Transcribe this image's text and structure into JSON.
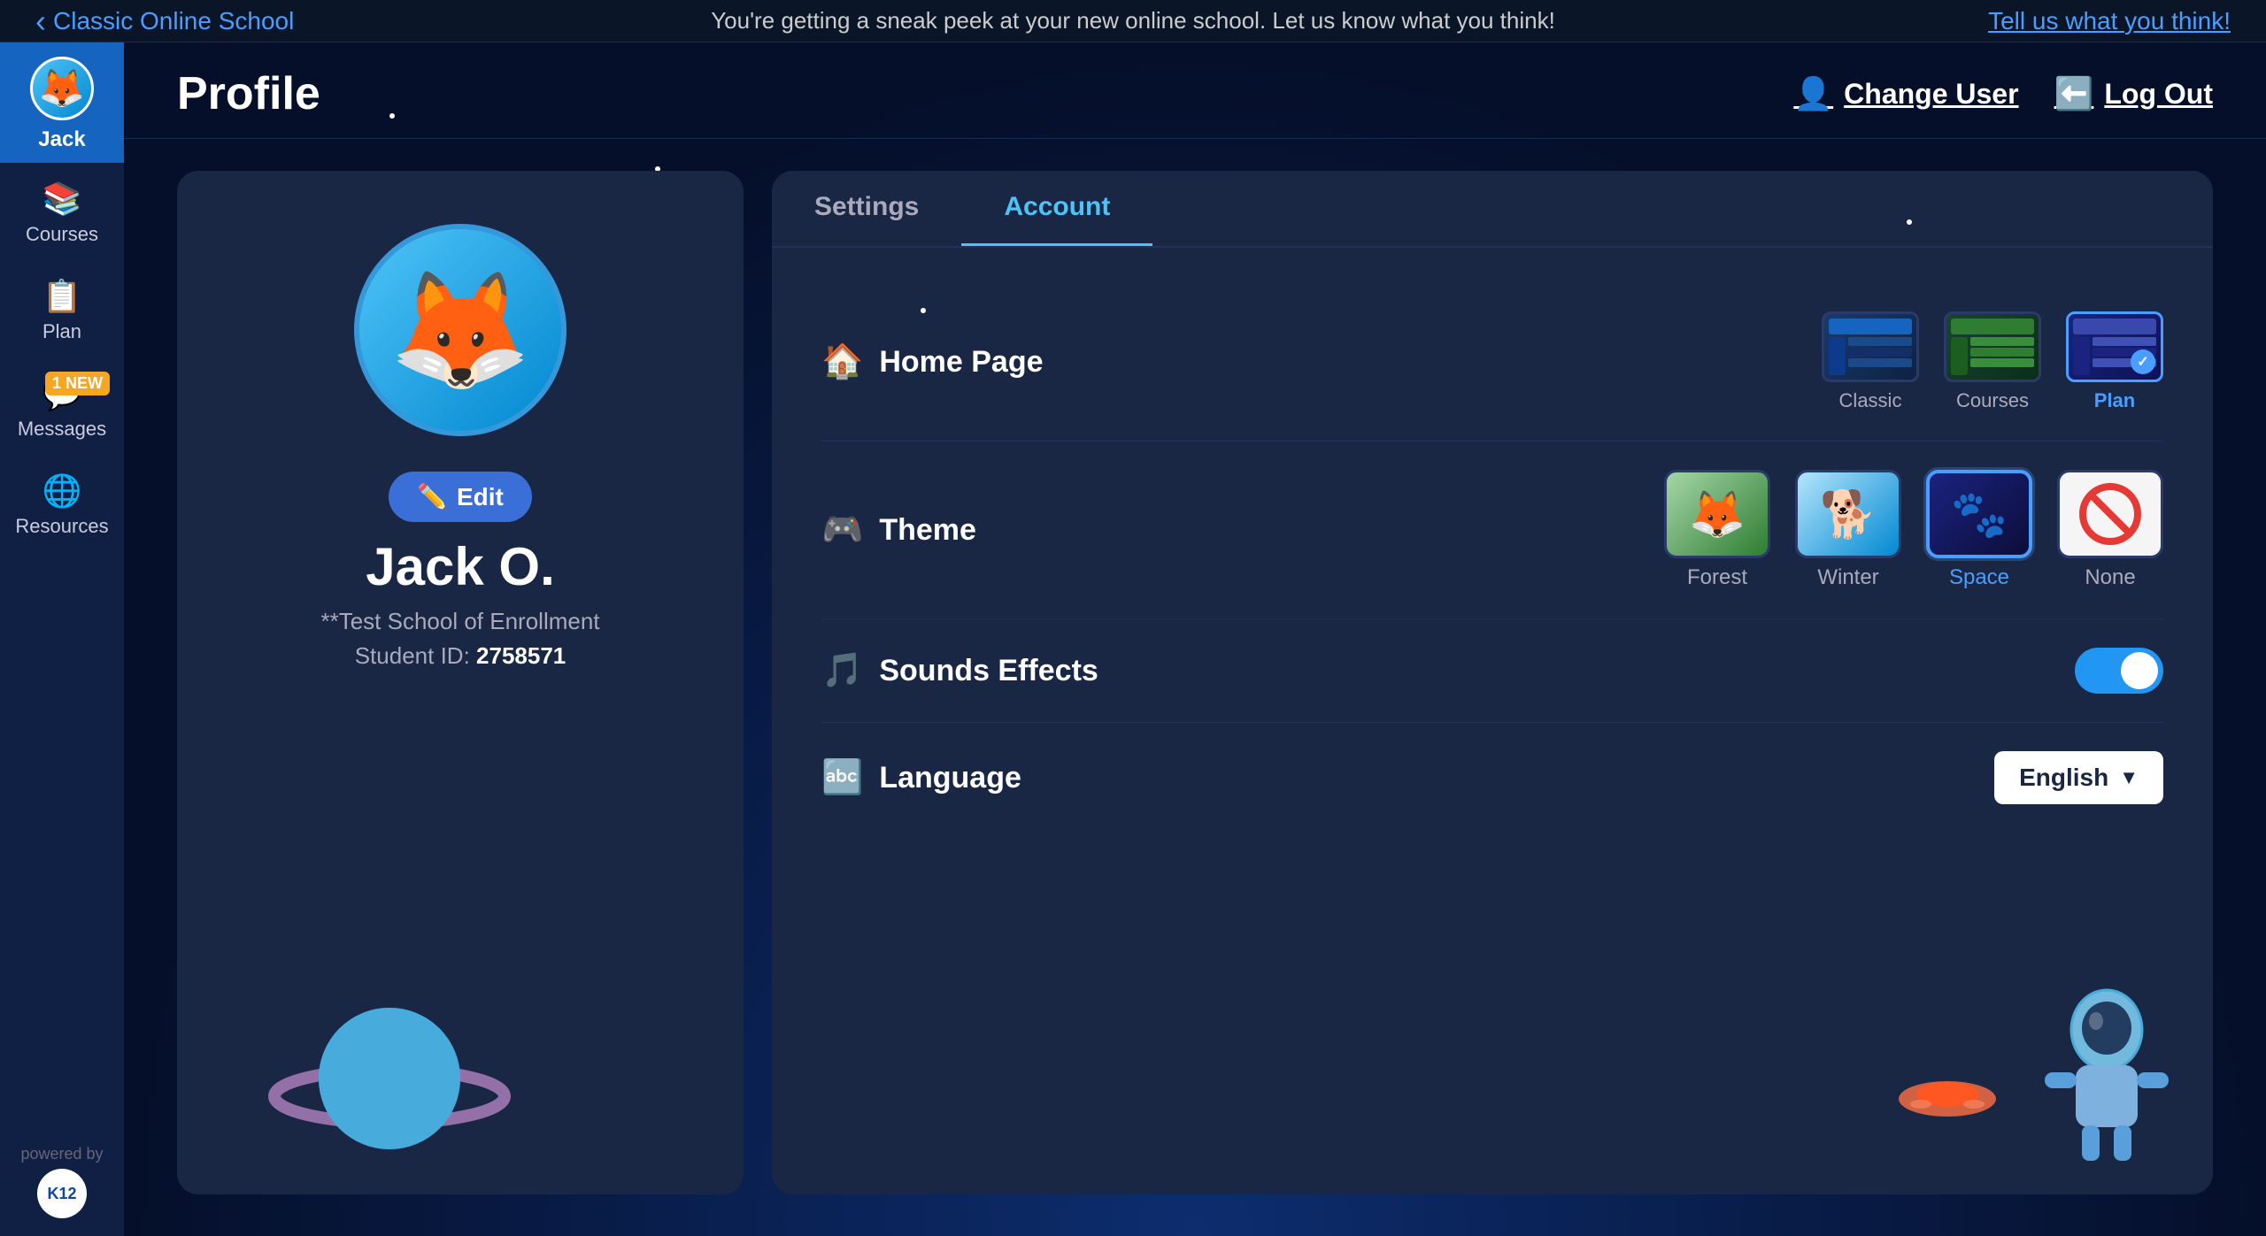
{
  "topBanner": {
    "backLink": "Classic Online School",
    "centerText": "You're getting a sneak peek at your new online school. Let us know what you think!",
    "feedbackLink": "Tell us what you think!"
  },
  "sidebar": {
    "username": "Jack",
    "items": [
      {
        "id": "courses",
        "label": "Courses",
        "icon": "📚"
      },
      {
        "id": "plan",
        "label": "Plan",
        "icon": "📋"
      },
      {
        "id": "messages",
        "label": "Messages",
        "icon": "💬",
        "badge": "1 NEW"
      },
      {
        "id": "resources",
        "label": "Resources",
        "icon": "🌐"
      }
    ],
    "poweredBy": "powered by",
    "k12": "K12"
  },
  "header": {
    "title": "Profile",
    "changeUserLabel": "Change User",
    "logOutLabel": "Log Out"
  },
  "profileCard": {
    "name": "Jack O.",
    "school": "**Test School of Enrollment",
    "studentIdLabel": "Student ID:",
    "studentId": "2758571",
    "editLabel": "Edit"
  },
  "settings": {
    "tabs": [
      {
        "id": "settings",
        "label": "Settings",
        "active": false
      },
      {
        "id": "account",
        "label": "Account",
        "active": true
      }
    ],
    "homePage": {
      "label": "Home Page",
      "icon": "🏠",
      "options": [
        {
          "id": "classic",
          "label": "Classic",
          "selected": false
        },
        {
          "id": "courses",
          "label": "Courses",
          "selected": false
        },
        {
          "id": "plan",
          "label": "Plan",
          "selected": true
        }
      ]
    },
    "theme": {
      "label": "Theme",
      "icon": "🎮",
      "options": [
        {
          "id": "forest",
          "label": "Forest",
          "selected": false,
          "emoji": "🦊"
        },
        {
          "id": "winter",
          "label": "Winter",
          "emoji": "🐕"
        },
        {
          "id": "space",
          "label": "Space",
          "selected": true,
          "emoji": "🐾"
        },
        {
          "id": "none",
          "label": "None",
          "emoji": "none"
        }
      ]
    },
    "soundEffects": {
      "label": "Sounds Effects",
      "icon": "🎵",
      "enabled": true
    },
    "language": {
      "label": "Language",
      "icon": "🔤",
      "currentValue": "English",
      "dropdownArrow": "▼"
    }
  },
  "colors": {
    "accent": "#4fc3f7",
    "sidebar": "#0f2044",
    "cardBg": "#1a2744",
    "tabActive": "#4fc3f7",
    "toggleOn": "#2196f3"
  }
}
